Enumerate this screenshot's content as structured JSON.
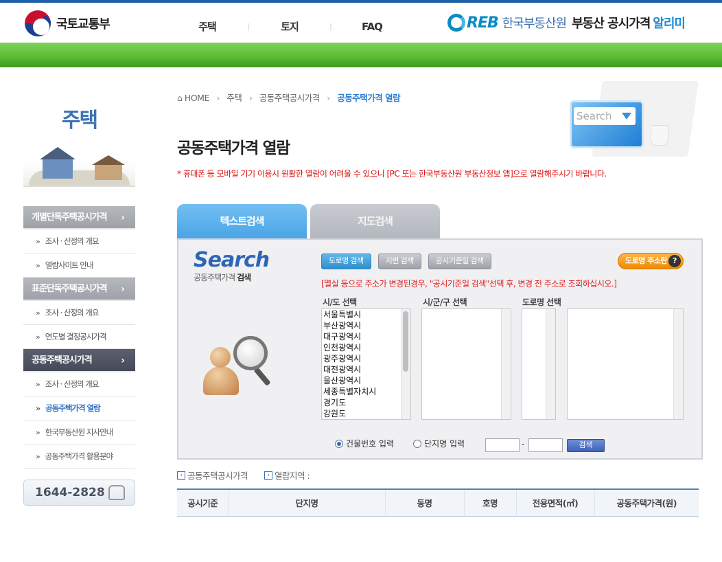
{
  "header": {
    "ministry": "국토교통부",
    "nav": [
      "주택",
      "토지",
      "FAQ"
    ],
    "reb_mark": "REB",
    "org": "한국부동산원",
    "service": "부동산 공시가격",
    "service_accent": "알리미"
  },
  "sidebar": {
    "title": "주택",
    "groups": [
      {
        "label": "개별단독주택공시가격",
        "active": false,
        "items": [
          {
            "label": "조사 · 산정의 개요",
            "current": false
          },
          {
            "label": "열람사이트 안내",
            "current": false
          }
        ]
      },
      {
        "label": "표준단독주택공시가격",
        "active": false,
        "items": [
          {
            "label": "조사 · 산정의 개요",
            "current": false
          },
          {
            "label": "연도별 결정공시가격",
            "current": false
          }
        ]
      },
      {
        "label": "공동주택공시가격",
        "active": true,
        "items": [
          {
            "label": "조사 · 산정의 개요",
            "current": false
          },
          {
            "label": "공동주택가격 열람",
            "current": true
          },
          {
            "label": "한국부동산원 지사안내",
            "current": false
          },
          {
            "label": "공동주택가격 활용분야",
            "current": false
          }
        ]
      }
    ],
    "phone": "1644-2828"
  },
  "breadcrumb": [
    "HOME",
    "주택",
    "공동주택공시가격",
    "공동주택가격 열람"
  ],
  "page_title": "공동주택가격 열람",
  "notice": "* 휴대폰 등 모바일 기기 이용시 원활한 열람이 어려울 수 있으니 [PC 또는 한국부동산원 부동산정보 앱]으로 열람해주시기 바랍니다.",
  "illustration_text": "Search",
  "tabs": [
    {
      "label": "텍스트검색",
      "active": true
    },
    {
      "label": "지도검색",
      "active": false
    }
  ],
  "search": {
    "logo_big": "Search",
    "logo_small_prefix": "공동주택가격 ",
    "logo_small_bold": "검색",
    "buttons": [
      {
        "label": "도로명 검색",
        "active": true
      },
      {
        "label": "지번 검색",
        "active": false
      },
      {
        "label": "공시기준일 검색",
        "active": false
      }
    ],
    "help_button": "도로명 주소란",
    "help_icon": "?",
    "hint": "[멸실 등으로 주소가 변경된경우, \"공시기준일 검색\"선택 후, 변경 전 주소로 조회하십시오.]",
    "labels": {
      "sido": "시/도 선택",
      "sigungu": "시/군/구 선택",
      "road": "도로명 선택"
    },
    "sido_options": [
      "서울특별시",
      "부산광역시",
      "대구광역시",
      "인천광역시",
      "광주광역시",
      "대전광역시",
      "울산광역시",
      "세종특별자치시",
      "경기도",
      "강원도"
    ],
    "radio_building": "건물번호 입력",
    "radio_complex": "단지명 입력",
    "selected_radio": "건물번호 입력",
    "dash": "-",
    "go_button": "검색"
  },
  "info": {
    "link1": "공동주택공시가격",
    "link2": "열람지역 :"
  },
  "table": {
    "columns": [
      "공시기준",
      "단지명",
      "동명",
      "호명",
      "전용면적(㎡)",
      "공동주택가격(원)"
    ]
  },
  "colors": {
    "accent_blue": "#2d7fd0",
    "green_bar": "#5bbd34",
    "notice_red": "#e01010"
  }
}
